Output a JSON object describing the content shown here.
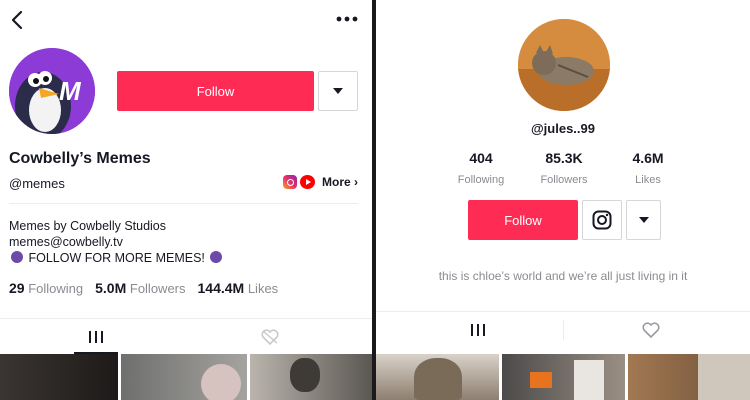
{
  "left_profile": {
    "display_name": "Cowbelly’s Memes",
    "username": "@memes",
    "avatar_letter": "M",
    "follow_label": "Follow",
    "more_label": "More",
    "more_chevron": "›",
    "bio_line1": "Memes by Cowbelly Studios",
    "bio_line2": "memes@cowbelly.tv",
    "bio_line3": "FOLLOW FOR MORE MEMES!",
    "stats": {
      "following_count": "29",
      "following_label": "Following",
      "followers_count": "5.0M",
      "followers_label": "Followers",
      "likes_count": "144.4M",
      "likes_label": "Likes"
    },
    "icons": [
      "back-icon",
      "more-options-icon",
      "instagram-icon",
      "youtube-icon",
      "grid-tab-icon",
      "liked-tab-icon"
    ]
  },
  "right_profile": {
    "username": "@jules..99",
    "follow_label": "Follow",
    "bio": "this is chloe’s world and we’re all just living in it",
    "stats": {
      "following_count": "404",
      "following_label": "Following",
      "followers_count": "85.3K",
      "followers_label": "Followers",
      "likes_count": "4.6M",
      "likes_label": "Likes"
    },
    "icons": [
      "instagram-icon",
      "dropdown-icon",
      "grid-tab-icon",
      "liked-tab-icon"
    ]
  },
  "colors": {
    "accent": "#fe2c55",
    "text": "#161823",
    "muted": "#8a8b91",
    "divider": "#ececec"
  }
}
